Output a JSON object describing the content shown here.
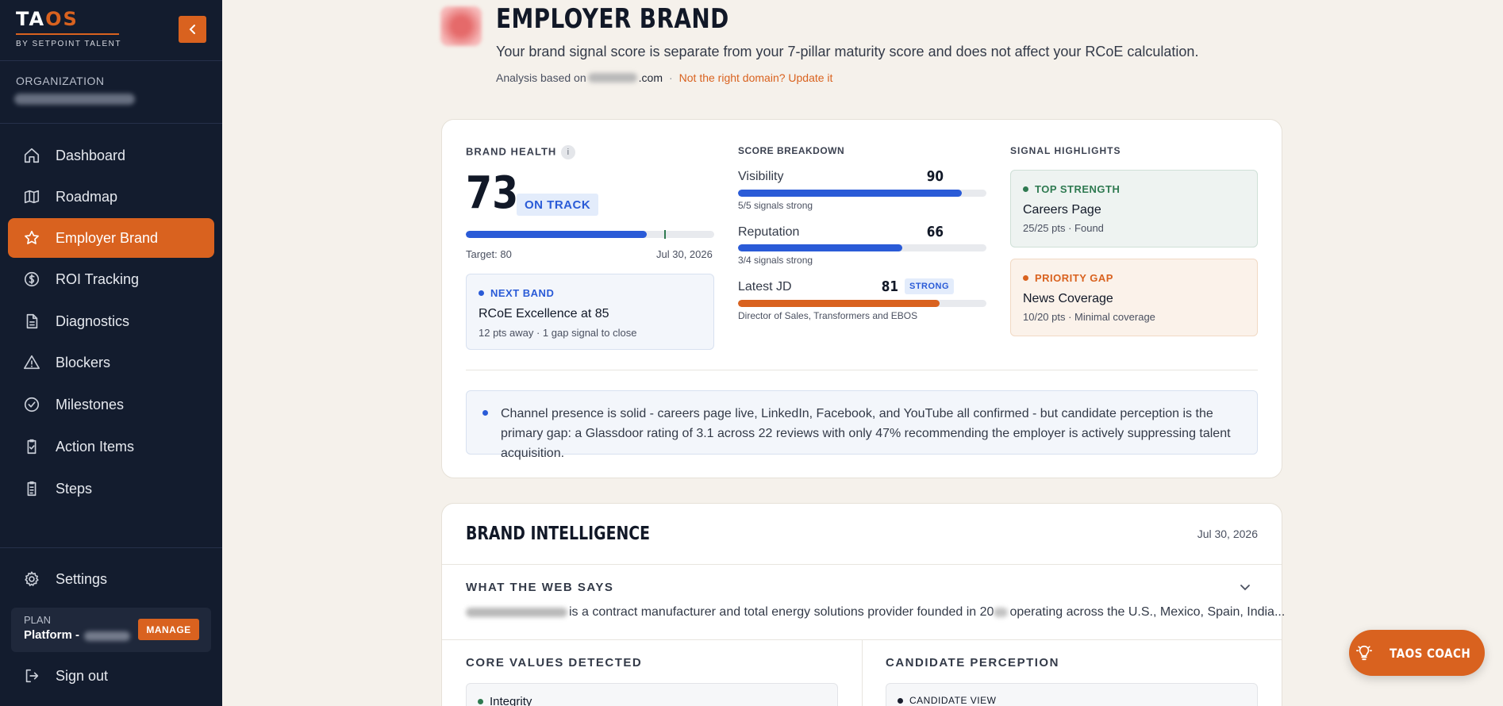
{
  "app": {
    "logo_left": "TA",
    "logo_right": "OS",
    "logo_sub": "BY SETPOINT TALENT"
  },
  "sidebar": {
    "org_label": "ORGANIZATION",
    "items": [
      {
        "label": "Dashboard",
        "icon": "home-icon"
      },
      {
        "label": "Roadmap",
        "icon": "map-icon"
      },
      {
        "label": "Employer Brand",
        "icon": "star-icon",
        "active": true
      },
      {
        "label": "ROI Tracking",
        "icon": "dollar-icon"
      },
      {
        "label": "Diagnostics",
        "icon": "document-icon"
      },
      {
        "label": "Blockers",
        "icon": "warning-icon"
      },
      {
        "label": "Milestones",
        "icon": "check-circle-icon"
      },
      {
        "label": "Action Items",
        "icon": "clipboard-check-icon"
      },
      {
        "label": "Steps",
        "icon": "clipboard-list-icon"
      }
    ],
    "settings_label": "Settings",
    "plan_label": "PLAN",
    "plan_name": "Platform -",
    "manage_label": "MANAGE",
    "signout_label": "Sign out"
  },
  "header": {
    "title": "EMPLOYER BRAND",
    "subtitle": "Your brand signal score is separate from your 7-pillar maturity score and does not affect your RCoE calculation.",
    "analysis_prefix": "Analysis based on",
    "analysis_domain_suffix": ".com",
    "analysis_sep": "·",
    "analysis_link": "Not the right domain? Update it"
  },
  "brand_health": {
    "label": "BRAND HEALTH",
    "info": "i",
    "score": "73",
    "status": "ON TRACK",
    "progress": 0.73,
    "target_fraction": 0.8,
    "target_label": "Target: 80",
    "date": "Jul 30, 2026",
    "next_band_label": "NEXT BAND",
    "next_band_title": "RCoE Excellence at 85",
    "next_band_sub": "12 pts away · 1 gap signal to close"
  },
  "score_breakdown": {
    "label": "SCORE BREAKDOWN",
    "items": [
      {
        "name": "Visibility",
        "value": "90",
        "fraction": 0.9,
        "sub": "5/5 signals strong",
        "color": "#2a5bd7"
      },
      {
        "name": "Reputation",
        "value": "66",
        "fraction": 0.66,
        "sub": "3/4 signals strong",
        "color": "#2a5bd7"
      },
      {
        "name": "Latest JD",
        "value": "81",
        "fraction": 0.81,
        "sub": "Director of Sales, Transformers and EBOS",
        "color": "#d9621f",
        "badge": "STRONG"
      }
    ]
  },
  "signal_highlights": {
    "label": "SIGNAL HIGHLIGHTS",
    "top": {
      "label": "TOP STRENGTH",
      "title": "Careers Page",
      "sub": "25/25 pts · Found",
      "color": "#2f7a51"
    },
    "gap": {
      "label": "PRIORITY GAP",
      "title": "News Coverage",
      "sub": "10/20 pts · Minimal coverage",
      "color": "#d9621f"
    }
  },
  "insight": "Channel presence is solid - careers page live, LinkedIn, Facebook, and YouTube all confirmed - but candidate perception is the primary gap: a Glassdoor rating of 3.1 across 22 reviews with only 47% recommending the employer is actively suppressing talent acquisition.",
  "intelligence": {
    "title": "BRAND INTELLIGENCE",
    "date": "Jul 30, 2026",
    "web_label": "WHAT THE WEB SAYS",
    "web_text_a": "is a contract manufacturer and total energy solutions provider founded in 20",
    "web_text_b": "operating across the U.S., Mexico, Spain, India...",
    "core_values_label": "CORE VALUES DETECTED",
    "core_value_first": "Integrity",
    "perception_label": "CANDIDATE PERCEPTION",
    "perception_first": "CANDIDATE VIEW"
  },
  "coach": {
    "label": "TAOS COACH"
  },
  "colors": {
    "accent": "#d9621f",
    "sidebar": "#131c2e",
    "blue": "#2a5bd7",
    "green": "#2f7a51"
  }
}
